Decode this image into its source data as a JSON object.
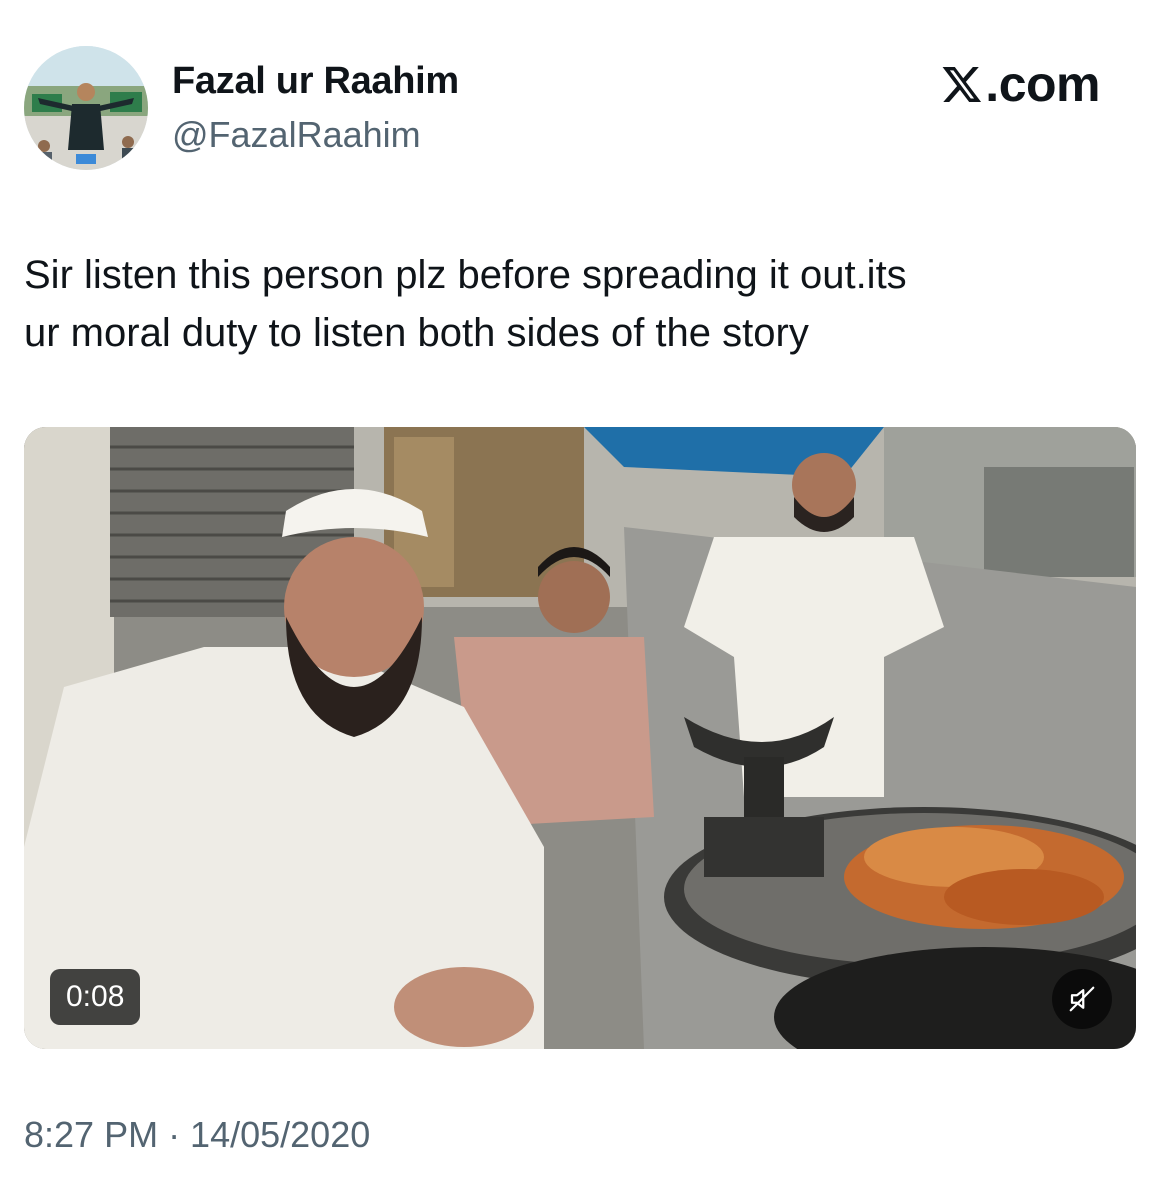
{
  "author": {
    "display_name": "Fazal ur Raahim",
    "handle": "@FazalRaahim"
  },
  "brand": {
    "text": ".com",
    "icon": "x-logo-icon"
  },
  "tweet": {
    "text": "Sir listen this person plz before spreading it out.its\nur moral duty to listen both sides of the story",
    "timestamp": "8:27 PM · 14/05/2020"
  },
  "media": {
    "type": "video",
    "duration": "0:08",
    "mute_icon": "speaker-muted-icon"
  },
  "colors": {
    "text_primary": "#0f1419",
    "text_secondary": "#536471",
    "background": "#ffffff"
  }
}
